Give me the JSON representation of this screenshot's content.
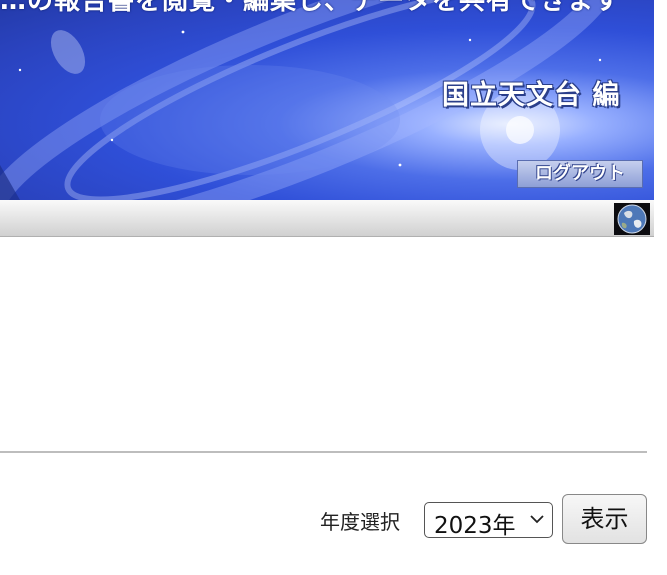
{
  "header": {
    "title_partial": "…の報告書を閲覧・編集し、データを共有できます",
    "editor_label": "国立天文台 編",
    "logout_label": "ログアウト"
  },
  "toolbar": {
    "globe_icon": "globe-icon"
  },
  "year_filter": {
    "label": "年度選択",
    "selected": "2023年",
    "submit_label": "表示"
  },
  "colors": {
    "banner": "#2f4fd8",
    "bar": "#e2e2e2"
  }
}
